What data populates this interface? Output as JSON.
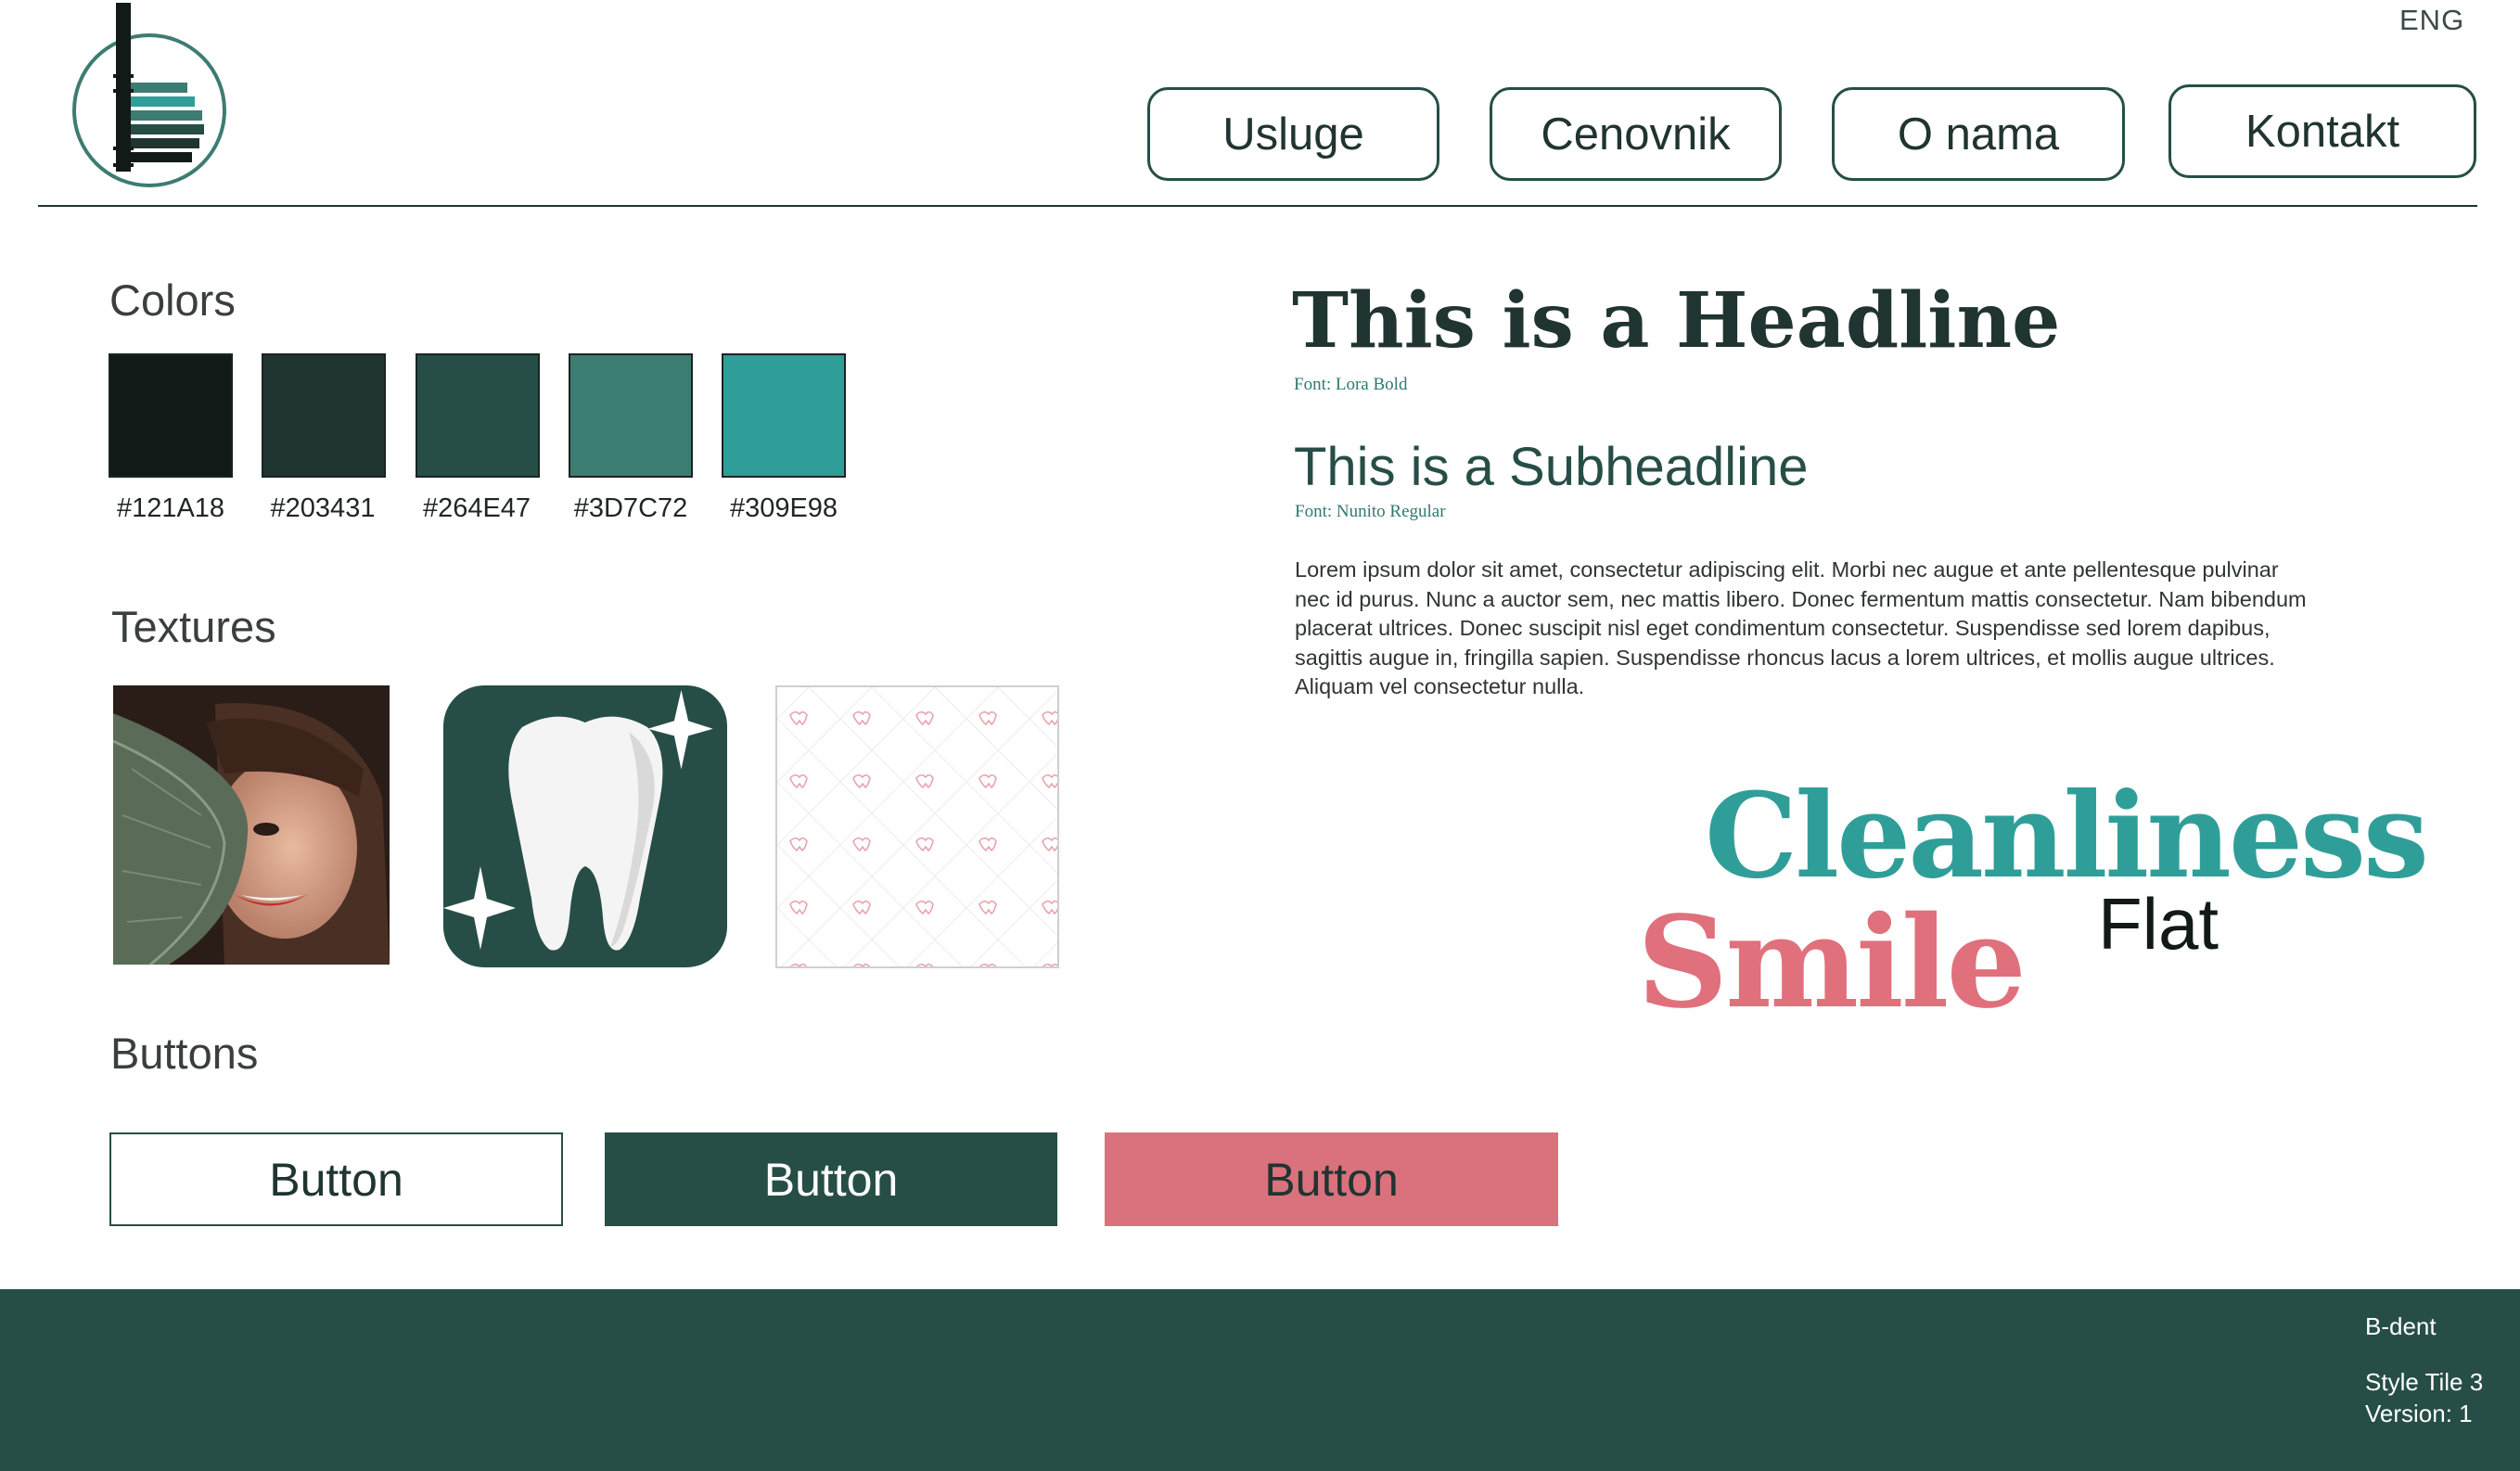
{
  "header": {
    "language": "ENG",
    "logo_name": "B-dent logo",
    "nav": [
      {
        "label": "Usluge"
      },
      {
        "label": "Cenovnik"
      },
      {
        "label": "O nama"
      },
      {
        "label": "Kontakt"
      }
    ]
  },
  "colors": {
    "title": "Colors",
    "swatches": [
      {
        "hex": "#121A18",
        "label": "#121A18"
      },
      {
        "hex": "#203431",
        "label": "#203431"
      },
      {
        "hex": "#264E47",
        "label": "#264E47"
      },
      {
        "hex": "#3D7C72",
        "label": "#3D7C72"
      },
      {
        "hex": "#309E98",
        "label": "#309E98"
      }
    ]
  },
  "textures": {
    "title": "Textures",
    "items": [
      "woman-with-leaf-photo",
      "tooth-sparkle-icon",
      "tooth-pattern"
    ]
  },
  "buttons": {
    "title": "Buttons",
    "items": [
      {
        "label": "Button",
        "style": "outline",
        "bg": "#ffffff",
        "text": "#203431"
      },
      {
        "label": "Button",
        "style": "dark",
        "bg": "#264E47",
        "text": "#ffffff"
      },
      {
        "label": "Button",
        "style": "pink",
        "bg": "#D9727C",
        "text": "#203431"
      }
    ]
  },
  "typography": {
    "headline": "This is a Headline",
    "headline_font": "Font: Lora Bold",
    "subheadline": "This is a Subheadline",
    "subheadline_font": "Font: Nunito Regular",
    "body": "Lorem ipsum dolor sit amet, consectetur adipiscing elit. Morbi nec augue et ante pellentesque pulvinar nec id purus. Nunc a auctor sem, nec mattis libero. Donec fermentum mattis consectetur. Nam bibendum placerat ultrices. Donec suscipit nisl eget condimentum consectetur. Suspendisse sed lorem dapibus, sagittis augue in, fringilla sapien. Suspendisse rhoncus lacus a lorem ultrices, et mollis augue ultrices. Aliquam vel consectetur nulla."
  },
  "keywords": {
    "cleanliness": "Cleanliness",
    "smile": "Smile",
    "flat": "Flat"
  },
  "footer": {
    "brand": "B-dent",
    "tile": "Style Tile 3",
    "version": "Version: 1"
  }
}
